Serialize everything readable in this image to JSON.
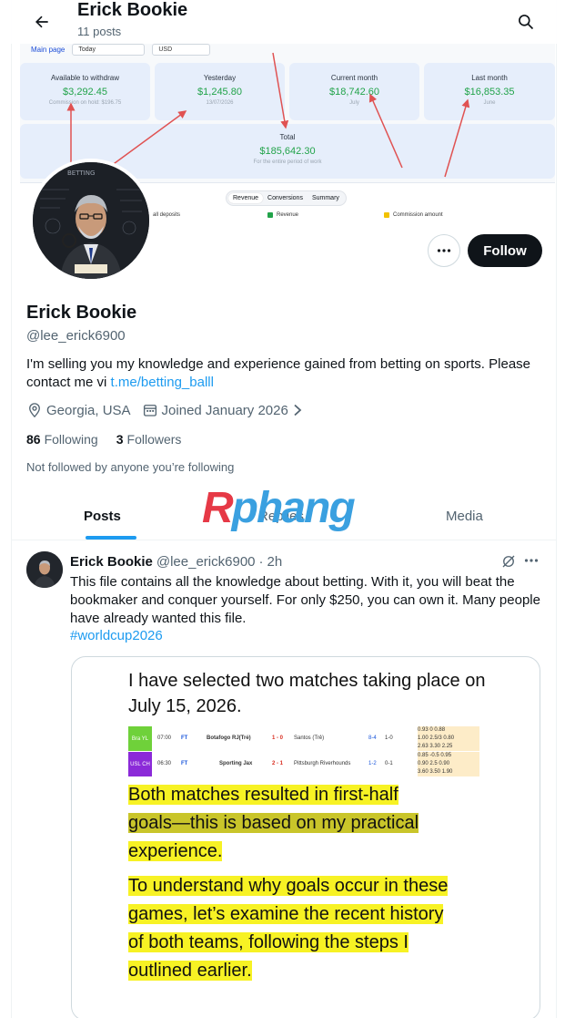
{
  "header": {
    "name": "Erick Bookie",
    "posts_count": "11 posts"
  },
  "banner": {
    "nav_label": "Main page",
    "period_select": "Today",
    "currency_select": "USD",
    "cards": [
      {
        "title": "Available to withdraw",
        "value": "$3,292.45",
        "sub": "Commission on hold: $196.75"
      },
      {
        "title": "Yesterday",
        "value": "$1,245.80",
        "sub": "13/07/2026"
      },
      {
        "title": "Current month",
        "value": "$18,742.60",
        "sub": "July"
      },
      {
        "title": "Last month",
        "value": "$16,853.35",
        "sub": "June"
      },
      {
        "title": "Total",
        "value": "$185,642.30",
        "sub": "For the entire period of work"
      }
    ],
    "segments": [
      "Revenue",
      "Conversions",
      "Summary"
    ],
    "legend": [
      "all deposits",
      "Revenue",
      "Commission amount"
    ]
  },
  "actions": {
    "follow_label": "Follow"
  },
  "profile": {
    "name": "Erick Bookie",
    "handle": "@lee_erick6900",
    "bio_text": "I'm selling you my knowledge and experience gained from betting on sports. Please contact me vi ",
    "bio_link": "t.me/betting_balll",
    "location": "Georgia, USA",
    "joined": "Joined January 2026",
    "following_count": "86",
    "following_label": "Following",
    "followers_count": "3",
    "followers_label": "Followers",
    "not_followed": "Not followed by anyone you’re following"
  },
  "tabs": [
    "Posts",
    "Replies",
    "Media"
  ],
  "watermark": {
    "part1": "R",
    "part2": "phang"
  },
  "post": {
    "name": "Erick Bookie",
    "handle": "@lee_erick6900",
    "sep": "·",
    "time": "2h",
    "text": "This file contains all the knowledge about betting. With it, you will beat the bookmaker and conquer yourself. For only $250, you can own it. Many people have already wanted this file.",
    "hashtag": "#worldcup2026",
    "media": {
      "heading": "I have selected two matches taking place on July 15, 2026.",
      "matches": [
        {
          "league": "Bra YL",
          "time": "07:00",
          "status": "FT",
          "home": "Botafogo RJ(Trẻ)",
          "score": "1 - 0",
          "away": "Santos (Trẻ)",
          "ht": "8-4",
          "hs": "1-0",
          "odds": [
            "0.93  0  0.88",
            "1.00 2.5/3 0.80",
            "2.63  3.30  2.25"
          ],
          "color": "#6fd13a"
        },
        {
          "league": "USL CH",
          "time": "06:30",
          "status": "FT",
          "home": "Sporting Jax",
          "score": "2 - 1",
          "away": "Pittsburgh Riverhounds",
          "ht": "1-2",
          "hs": "0-1",
          "odds": [
            "0.85  -0.5  0.95",
            "0.90  2.5  0.90",
            "3.60  3.50  1.90"
          ],
          "color": "#8b2ad8"
        }
      ],
      "para1": [
        "Both matches resulted in first-half",
        "goals—this is based on my practical",
        "experience."
      ],
      "para2": [
        "To understand why goals occur in these",
        "games, let’s examine the recent history",
        "of both teams, following the steps I",
        "outlined earlier."
      ]
    }
  }
}
